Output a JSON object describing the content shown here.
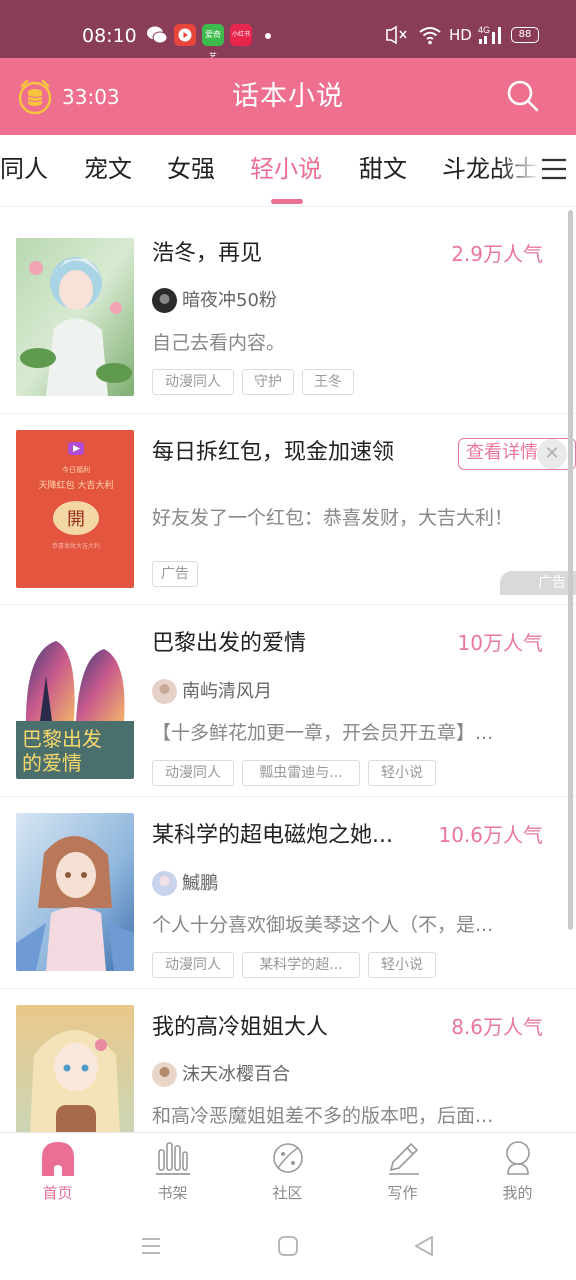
{
  "status_bar": {
    "time": "08:10",
    "hd": "HD",
    "network": "4G",
    "battery": "88",
    "app_badges": [
      "爱奇艺",
      "小红书"
    ]
  },
  "header": {
    "timer": "33:03",
    "title": "话本小说"
  },
  "tabs": [
    "同人",
    "宠文",
    "女强",
    "轻小说",
    "甜文",
    "斗龙战士"
  ],
  "active_tab": "轻小说",
  "cards": [
    {
      "title": "浩冬，再见",
      "popularity": "2.9万人气",
      "author": "暗夜冲50粉",
      "desc": "自己去看内容。",
      "tags": [
        "动漫同人",
        "守护",
        "王冬"
      ]
    },
    {
      "title": "每日拆红包，现金加速领",
      "button": "查看详情",
      "desc": "好友发了一个红包：恭喜发财，大吉大利！",
      "tags": [
        "广告"
      ],
      "ad_mark": "广告",
      "cover_text": {
        "line1": "今日福利",
        "line2": "天降红包 大吉大利",
        "open": "開",
        "footer": "恭喜发财大吉大利"
      }
    },
    {
      "title": "巴黎出发的爱情",
      "popularity": "10万人气",
      "author": "南屿清风月",
      "desc": "【十多鲜花加更一章，开会员开五章】...",
      "tags": [
        "动漫同人",
        "瓢虫雷迪与...",
        "轻小说"
      ],
      "cover_text": "巴黎出发的爱情"
    },
    {
      "title": "某科学的超电磁炮之她...",
      "popularity": "10.6万人气",
      "author": "鰄鵬",
      "desc": "个人十分喜欢御坂美琴这个人（不，是...",
      "tags": [
        "动漫同人",
        "某科学的超...",
        "轻小说"
      ]
    },
    {
      "title": "我的高冷姐姐大人",
      "popularity": "8.6万人气",
      "author": "沫天冰樱百合",
      "desc": "和高冷恶魔姐姐差不多的版本吧，后面..."
    }
  ],
  "bottom_nav": [
    {
      "label": "首页",
      "icon": "home-icon",
      "active": true
    },
    {
      "label": "书架",
      "icon": "bookshelf-icon",
      "active": false
    },
    {
      "label": "社区",
      "icon": "community-planet-icon",
      "active": false
    },
    {
      "label": "写作",
      "icon": "pencil-icon",
      "active": false
    },
    {
      "label": "我的",
      "icon": "profile-icon",
      "active": false
    }
  ],
  "colors": {
    "status_bar": "#8a3d58",
    "header": "#ef6f8f",
    "accent": "#ea6f92"
  }
}
